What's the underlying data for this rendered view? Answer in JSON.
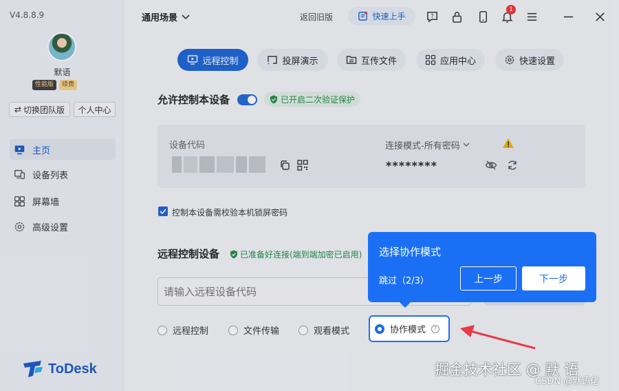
{
  "app": {
    "version": "V4.8.8.9",
    "username": "默语",
    "badges": [
      "性能版",
      "续费"
    ],
    "switch_team": "切换团队版",
    "personal_center": "个人中心",
    "logo": "ToDesk"
  },
  "sidebar": {
    "items": [
      {
        "label": "主页",
        "icon": "monitor-icon",
        "active": true
      },
      {
        "label": "设备列表",
        "icon": "device-list-icon",
        "active": false
      },
      {
        "label": "屏幕墙",
        "icon": "grid-icon",
        "active": false
      },
      {
        "label": "高级设置",
        "icon": "gear-icon",
        "active": false
      }
    ]
  },
  "topbar": {
    "scene": "通用场景",
    "old_version": "返回旧版",
    "quick_start": "快速上手",
    "notification_count": "1"
  },
  "tabs": [
    {
      "label": "远程控制",
      "active": true
    },
    {
      "label": "投屏演示",
      "active": false
    },
    {
      "label": "互传文件",
      "active": false
    },
    {
      "label": "应用中心",
      "active": false
    },
    {
      "label": "快速设置",
      "active": false
    }
  ],
  "allow": {
    "title": "允许控制本设备",
    "verify_badge": "已开启二次验证保护"
  },
  "device": {
    "code_label": "设备代码",
    "connection_mode": "连接模式-所有密码",
    "password": "********"
  },
  "lock_check_label": "控制本设备需校验本机锁屏密码",
  "remote": {
    "title": "远程控制设备",
    "ready_text": "已准备好连接(端到端加密已启用)",
    "input_placeholder": "请输入远程设备代码",
    "modes": [
      "远程控制",
      "文件传输",
      "观看模式",
      "协作模式"
    ]
  },
  "tooltip": {
    "title": "选择协作模式",
    "skip": "跳过（2/3）",
    "prev": "上一步",
    "next": "下一步"
  },
  "watermark": "掘金技术社区 @ 默 语",
  "csdn": "CSDN @默语佬",
  "colors": {
    "accent": "#1862d6",
    "tooltip": "#1a6ff5",
    "success": "#1f8a45",
    "arrow": "#e8394a"
  }
}
